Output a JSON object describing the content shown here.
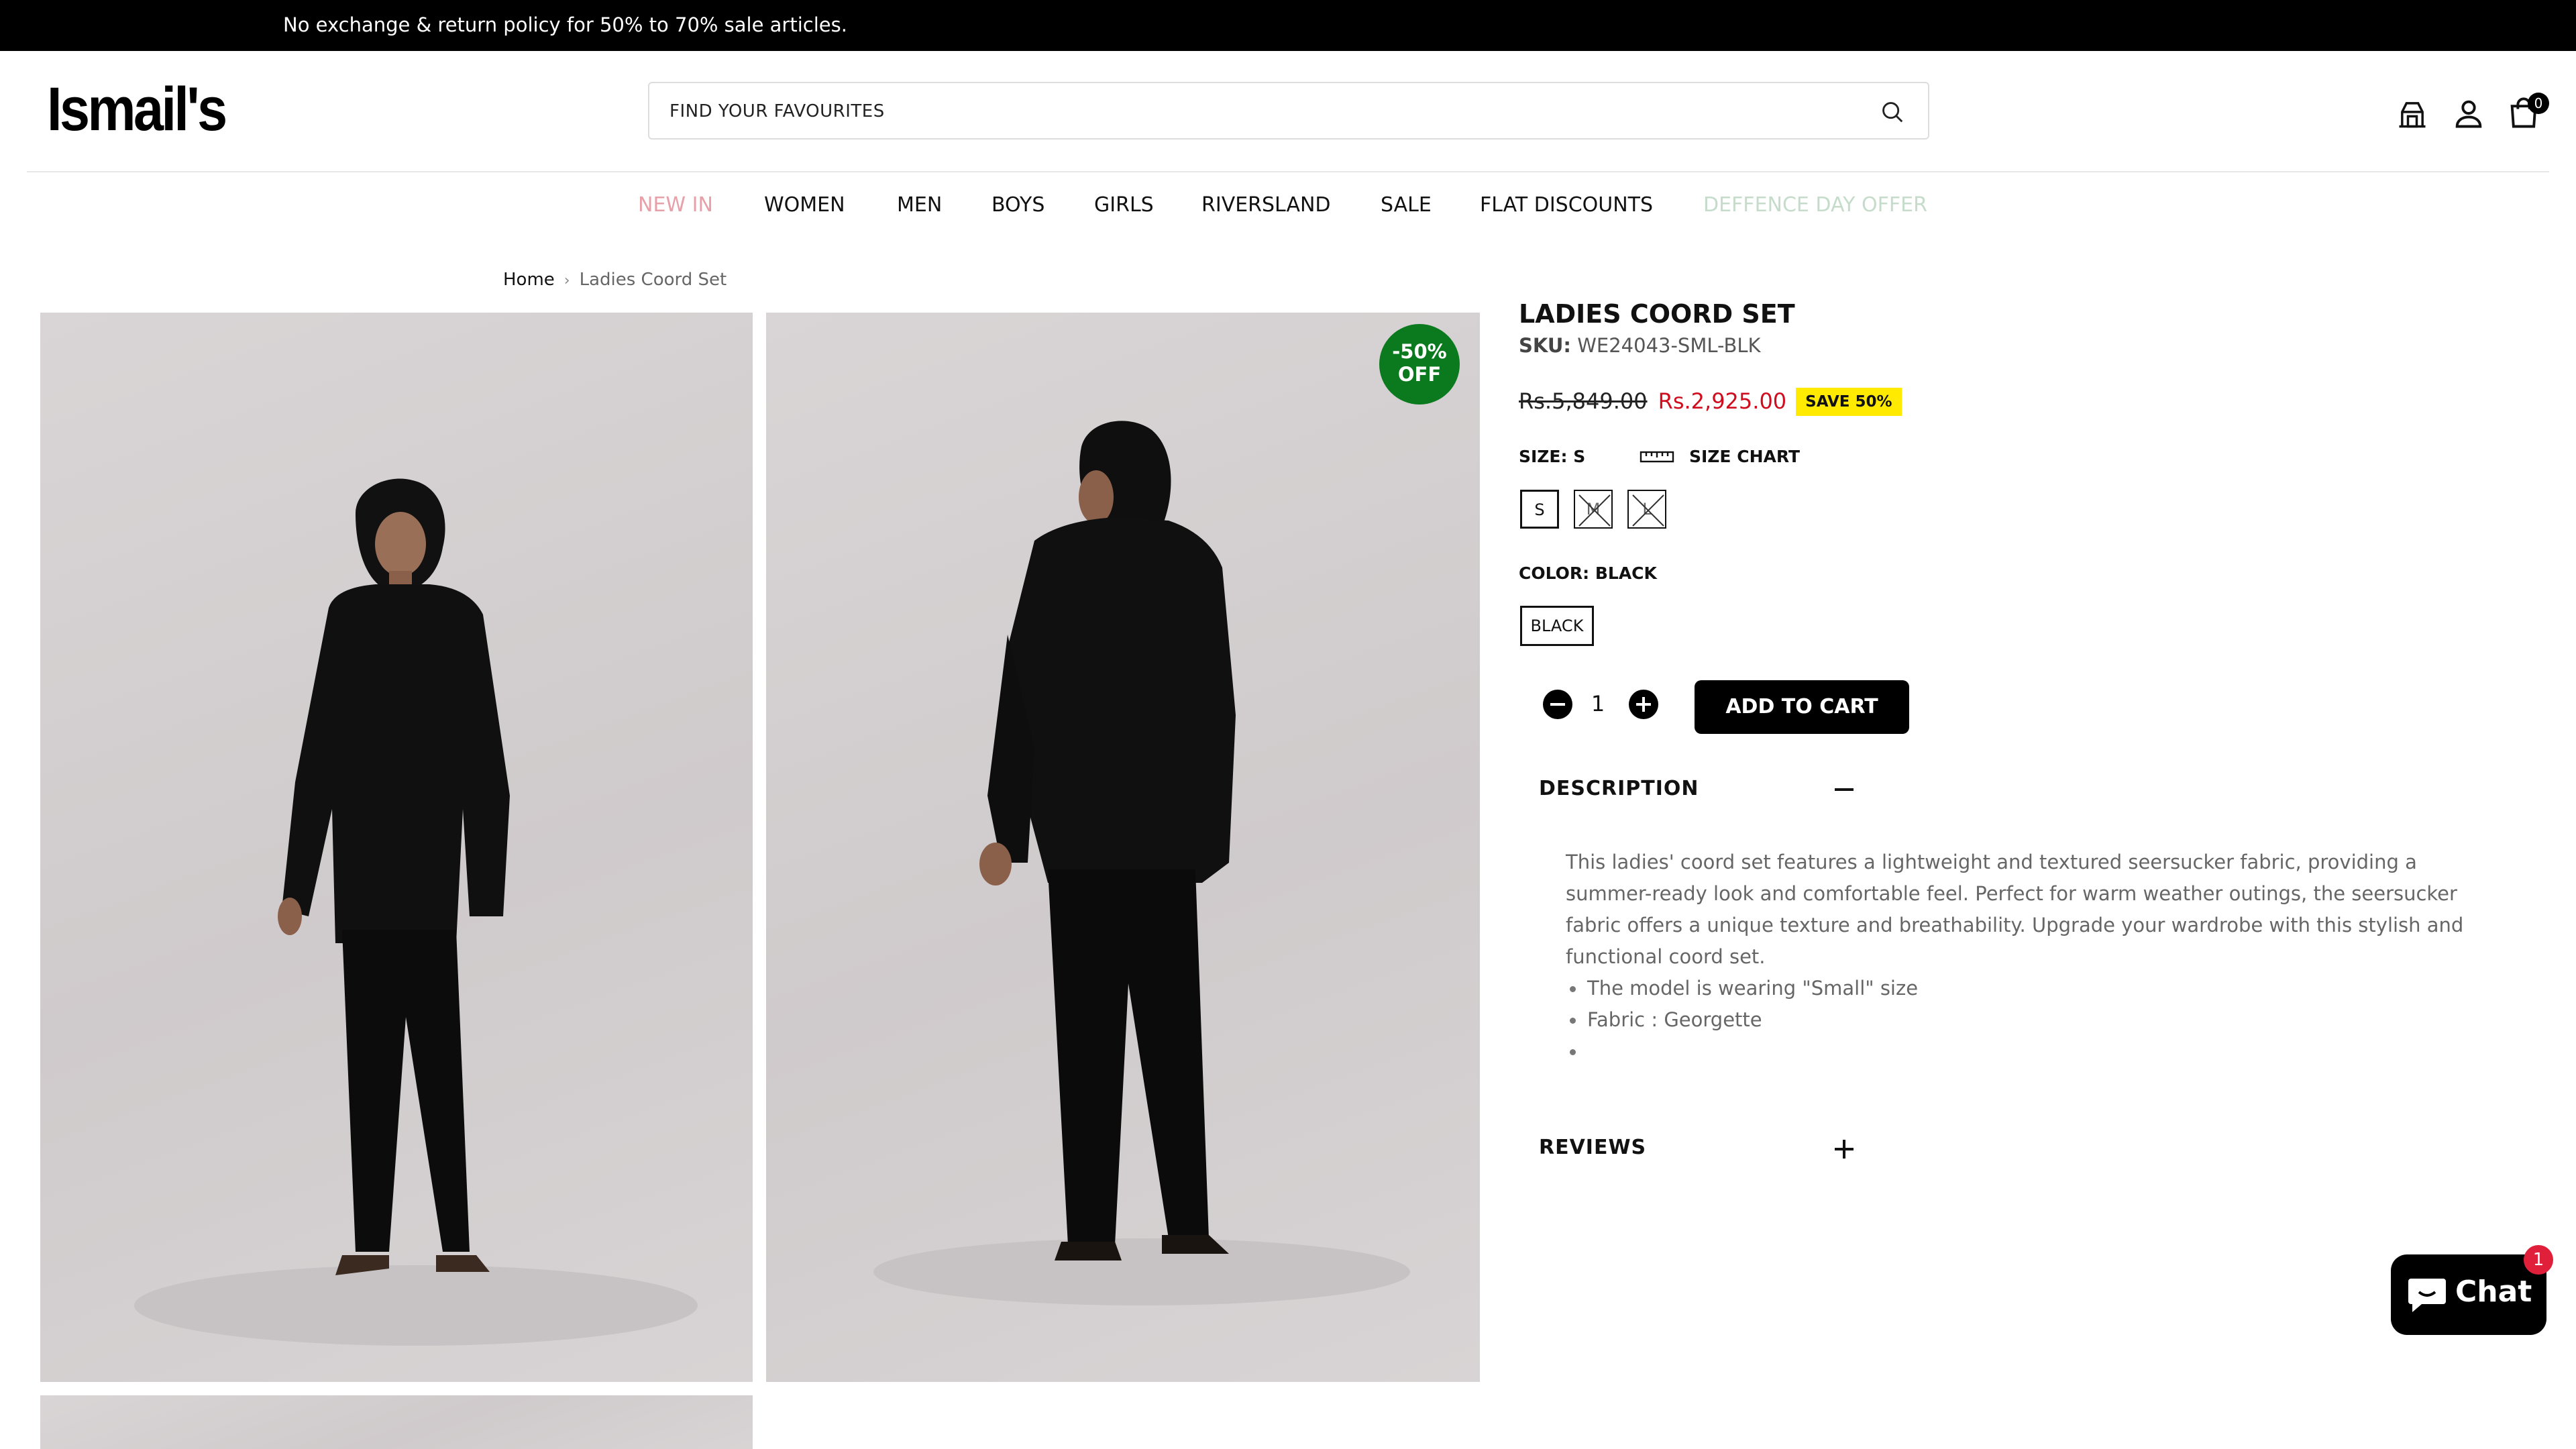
{
  "announcement": {
    "text": "No exchange & return policy for 50% to 70% sale articles."
  },
  "header": {
    "logo_text": "Ismail's",
    "search_placeholder": "FIND YOUR FAVOURITES",
    "cart_count": "0",
    "icons": [
      "store-locator-icon",
      "user-icon",
      "shopping-bag-icon",
      "search-icon"
    ]
  },
  "nav": {
    "items": [
      {
        "label": "NEW IN",
        "color": "#e8a0a8"
      },
      {
        "label": "WOMEN"
      },
      {
        "label": "MEN"
      },
      {
        "label": "BOYS"
      },
      {
        "label": "GIRLS"
      },
      {
        "label": "RIVERSLAND"
      },
      {
        "label": "SALE"
      },
      {
        "label": "FLAT DISCOUNTS"
      },
      {
        "label": "DEFFENCE DAY OFFER",
        "color": "#c5dccb"
      }
    ]
  },
  "breadcrumb": {
    "home": "Home",
    "current": "Ladies Coord Set"
  },
  "gallery": {
    "discount_line1": "-50%",
    "discount_line2": "OFF",
    "badge_color": "#0b7a1e"
  },
  "product": {
    "title": "LADIES COORD SET",
    "sku_label": "SKU:",
    "sku_value": "WE24043-SML-BLK",
    "price_old": "Rs.5,849.00",
    "price_new": "Rs.2,925.00",
    "save_badge": "SAVE 50%",
    "size_label": "SIZE: S",
    "size_chart": "SIZE CHART",
    "sizes": [
      "S",
      "M",
      "L"
    ],
    "color_label": "COLOR: BLACK",
    "color_option": "BLACK",
    "quantity": "1",
    "add_to_cart": "ADD TO CART",
    "price_color": "#d00d1f",
    "save_badge_color": "#ffea00"
  },
  "description": {
    "title": "DESCRIPTION",
    "body": "This ladies' coord set features a lightweight and textured seersucker fabric, providing a summer-ready look and comfortable feel. Perfect for warm weather outings, the seersucker fabric offers a unique texture and breathability. Upgrade your wardrobe with this stylish and functional coord set.",
    "bullets": [
      "The model is wearing \"Small\" size",
      "Fabric : Georgette",
      ""
    ]
  },
  "reviews": {
    "title": "REVIEWS"
  },
  "chat": {
    "label": "Chat",
    "badge": "1"
  }
}
